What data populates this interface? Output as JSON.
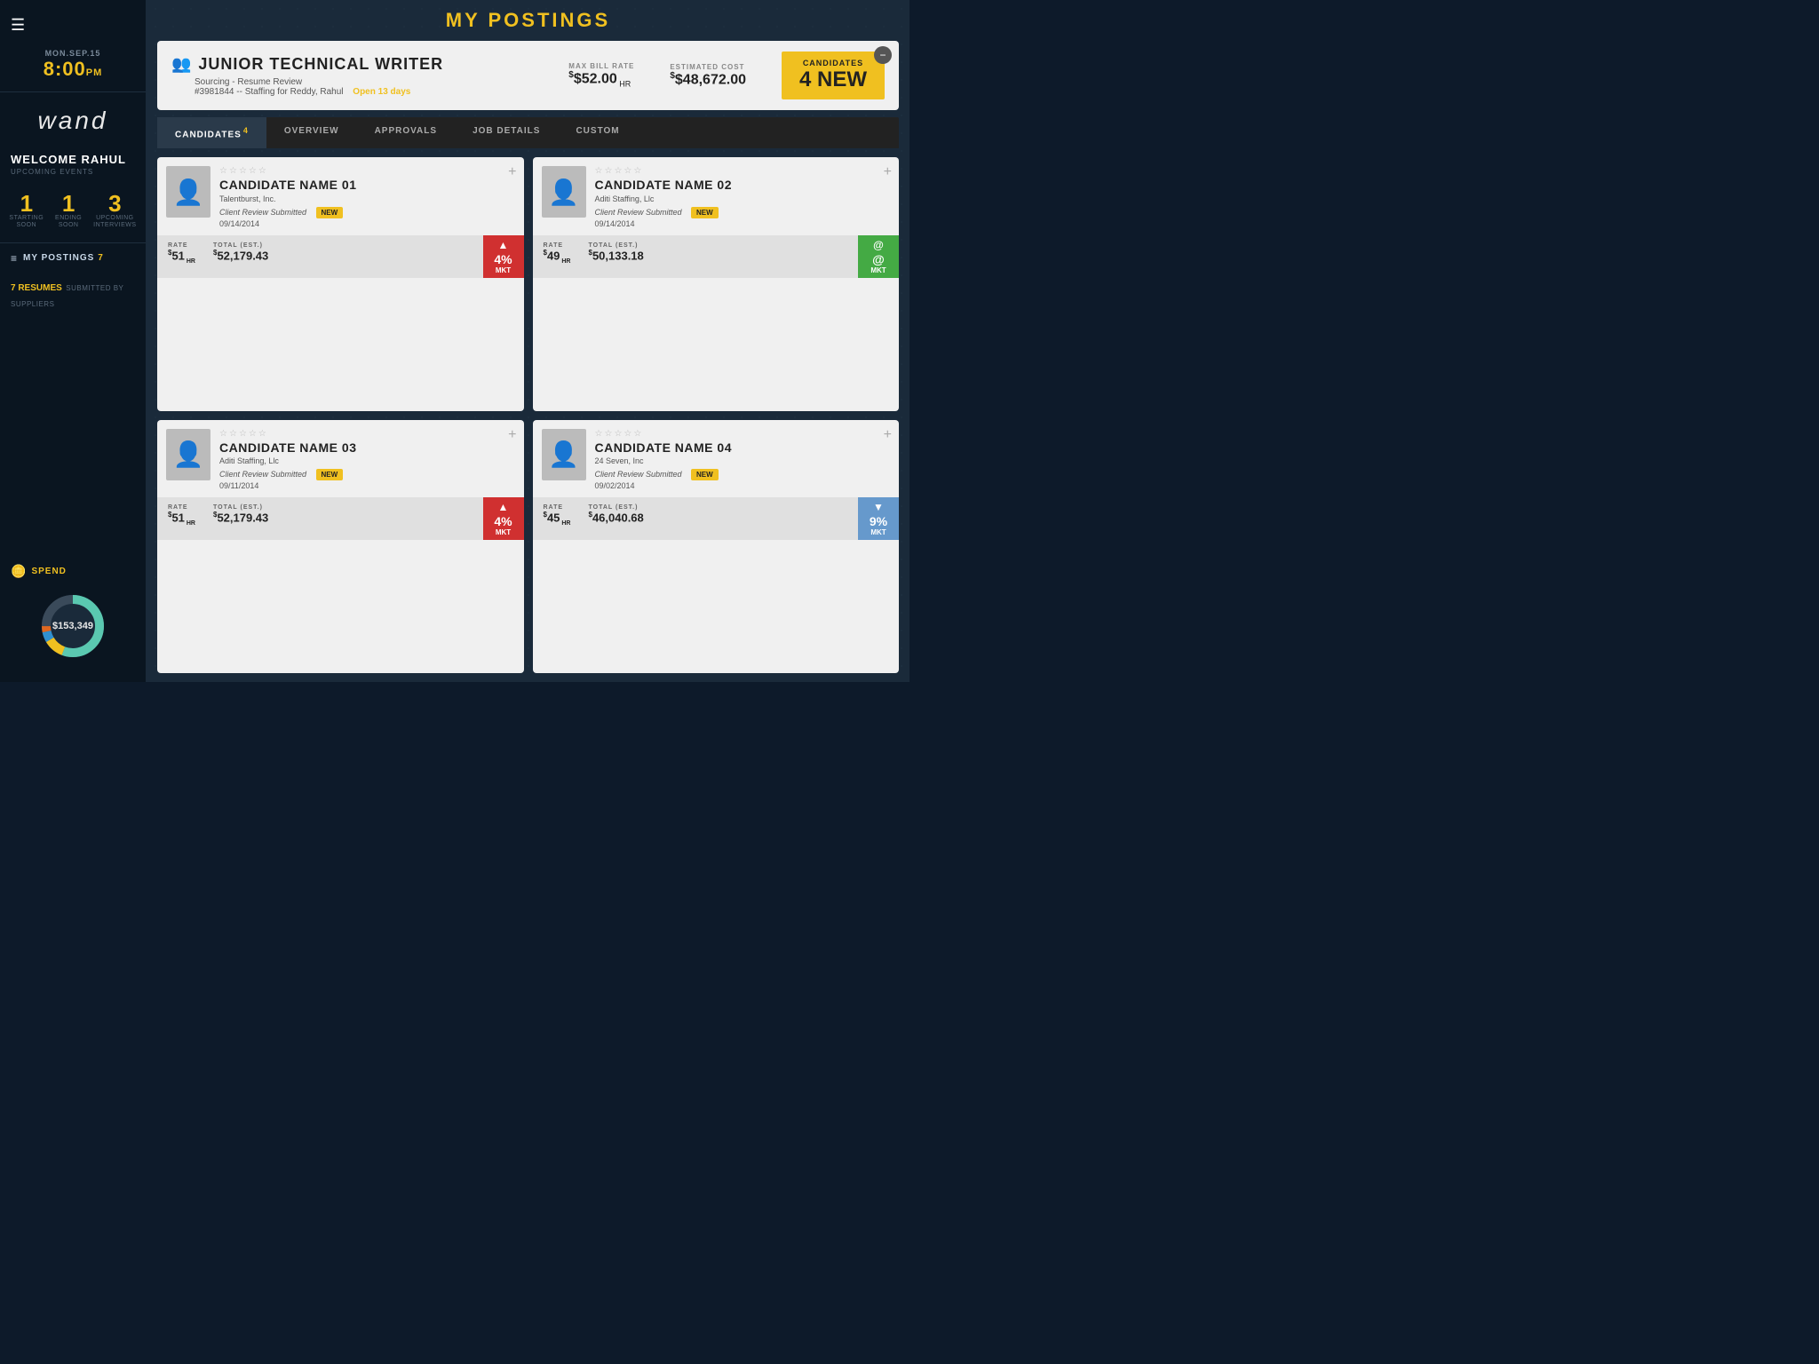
{
  "app": {
    "title": "MY POSTINGS"
  },
  "sidebar": {
    "datetime": {
      "day": "MON.SEP.15",
      "time": "8:00",
      "ampm": "PM"
    },
    "logo": "wand",
    "welcome": {
      "name": "WELCOME RAHUL",
      "upcoming_label": "UPCOMING EVENTS"
    },
    "events": [
      {
        "number": "1",
        "line1": "STARTING",
        "line2": "SOON"
      },
      {
        "number": "1",
        "line1": "ENDING",
        "line2": "SOON"
      },
      {
        "number": "3",
        "line1": "UPCOMING",
        "line2": "INTERVIEWS"
      }
    ],
    "my_postings": {
      "label": "MY POSTINGS",
      "count": "7"
    },
    "resumes": {
      "count": "7 RESUMES",
      "text": "SUBMITTED BY SUPPLIERS"
    },
    "spend": {
      "label": "SPEND",
      "amount": "$153,349"
    }
  },
  "job": {
    "icon": "👥",
    "title": "JUNIOR TECHNICAL WRITER",
    "subtitle": "Sourcing - Resume Review",
    "ref": "#3981844 -- Staffing for Reddy, Rahul",
    "open_days": "Open 13 days",
    "max_bill_rate_label": "MAX BILL RATE",
    "max_bill_rate": "$52.00",
    "max_bill_rate_unit": "HR",
    "estimated_cost_label": "ESTIMATED COST",
    "estimated_cost": "$48,672.00",
    "candidates_label": "CANDIDATES",
    "candidates_value": "4 NEW"
  },
  "tabs": [
    {
      "id": "candidates",
      "label": "CANDIDATES",
      "badge": "4",
      "active": true
    },
    {
      "id": "overview",
      "label": "OVERVIEW",
      "badge": "",
      "active": false
    },
    {
      "id": "approvals",
      "label": "APPROVALS",
      "badge": "",
      "active": false
    },
    {
      "id": "job_details",
      "label": "JOB DETAILS",
      "badge": "",
      "active": false
    },
    {
      "id": "custom",
      "label": "CUSTOM",
      "badge": "",
      "active": false
    }
  ],
  "candidates": [
    {
      "id": 1,
      "name": "CANDIDATE NAME 01",
      "company": "Talentburst, Inc.",
      "status": "Client Review  Submitted",
      "date": "09/14/2014",
      "is_new": true,
      "rate_label": "RATE",
      "rate": "$51",
      "rate_unit": "HR",
      "total_label": "TOTAL (EST.)",
      "total": "$52,179.43",
      "mkt_type": "up",
      "mkt_pct": "4%",
      "mkt_label": "MKT"
    },
    {
      "id": 2,
      "name": "CANDIDATE NAME 02",
      "company": "Aditi Staffing, Llc",
      "status": "Client Review  Submitted",
      "date": "09/14/2014",
      "is_new": true,
      "rate_label": "RATE",
      "rate": "$49",
      "rate_unit": "HR",
      "total_label": "TOTAL (EST.)",
      "total": "$50,133.18",
      "mkt_type": "at",
      "mkt_pct": "@",
      "mkt_label": "MKT"
    },
    {
      "id": 3,
      "name": "CANDIDATE NAME 03",
      "company": "Aditi Staffing, Llc",
      "status": "Client Review  Submitted",
      "date": "09/11/2014",
      "is_new": true,
      "rate_label": "RATE",
      "rate": "$51",
      "rate_unit": "HR",
      "total_label": "TOTAL (EST.)",
      "total": "$52,179.43",
      "mkt_type": "up",
      "mkt_pct": "4%",
      "mkt_label": "MKT"
    },
    {
      "id": 4,
      "name": "CANDIDATE NAME 04",
      "company": "24 Seven, Inc",
      "status": "Client Review  Submitted",
      "date": "09/02/2014",
      "is_new": true,
      "rate_label": "RATE",
      "rate": "$45",
      "rate_unit": "HR",
      "total_label": "TOTAL (EST.)",
      "total": "$46,040.68",
      "mkt_type": "down",
      "mkt_pct": "9%",
      "mkt_label": "MKT"
    }
  ]
}
